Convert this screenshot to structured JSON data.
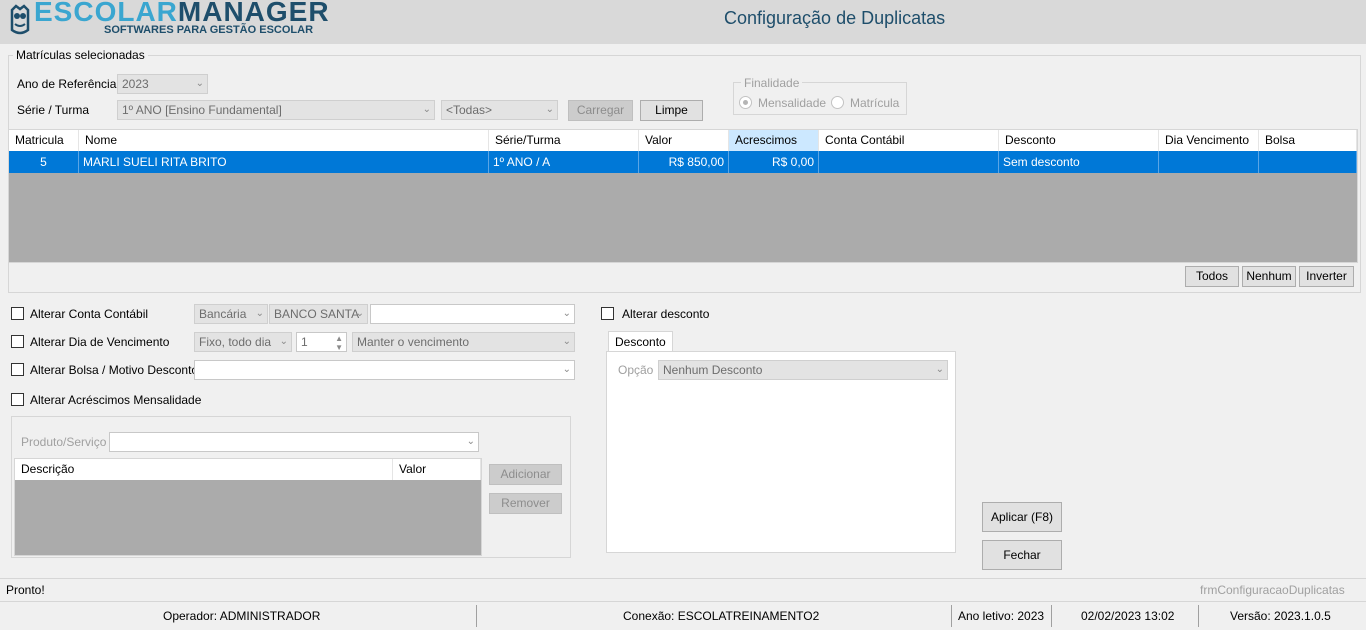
{
  "app": {
    "logo_main_a": "ESCOLAR",
    "logo_main_b": "MANAGER",
    "logo_sub": "SOFTWARES PARA GESTÃO ESCOLAR",
    "title": "Configuração de Duplicatas"
  },
  "matriculas": {
    "group_title": "Matrículas selecionadas",
    "ano_label": "Ano de Referência",
    "ano_value": "2023",
    "serie_label": "Série / Turma",
    "serie_value": "1º ANO [Ensino Fundamental]",
    "turma_value": "<Todas>",
    "carregar": "Carregar",
    "limpe": "Limpe",
    "finalidade": {
      "title": "Finalidade",
      "mensalidade": "Mensalidade",
      "matricula": "Matrícula"
    }
  },
  "grid": {
    "columns": [
      "Matricula",
      "Nome",
      "Série/Turma",
      "Valor",
      "Acrescimos",
      "Conta Contábil",
      "Desconto",
      "Dia Vencimento",
      "Bolsa"
    ],
    "rows": [
      {
        "matricula": "5",
        "nome": "MARLI SUELI RITA BRITO",
        "serie": "1º ANO / A",
        "valor": "R$ 850,00",
        "acrescimos": "R$ 0,00",
        "conta": "",
        "desconto": "Sem desconto",
        "dia": "",
        "bolsa": ""
      }
    ],
    "btn_todos": "Todos",
    "btn_nenhum": "Nenhum",
    "btn_inverter": "Inverter"
  },
  "options": {
    "alterar_conta": "Alterar Conta Contábil",
    "conta_tipo": "Bancária",
    "conta_banco": "BANCO SANTA",
    "conta_extra": "",
    "alterar_dia": "Alterar Dia de Vencimento",
    "dia_tipo": "Fixo, todo dia",
    "dia_num": "1",
    "dia_manter": "Manter o vencimento",
    "alterar_bolsa": "Alterar Bolsa / Motivo Desconto",
    "bolsa_value": "",
    "alterar_acrescimos": "Alterar Acréscimos Mensalidade",
    "produto_label": "Produto/Serviço",
    "produto_value": "",
    "desc_col": "Descrição",
    "valor_col": "Valor",
    "adicionar": "Adicionar",
    "remover": "Remover"
  },
  "desconto": {
    "alterar_desconto": "Alterar desconto",
    "tab": "Desconto",
    "opcao_label": "Opção",
    "opcao_value": "Nenhum Desconto"
  },
  "actions": {
    "aplicar": "Aplicar (F8)",
    "fechar": "Fechar"
  },
  "status": {
    "pronto": "Pronto!",
    "form_name": "frmConfiguracaoDuplicatas"
  },
  "statusbar": {
    "operador": "Operador: ADMINISTRADOR",
    "conexao": "Conexão: ESCOLATREINAMENTO2",
    "ano_letivo": "Ano letivo: 2023",
    "datetime": "02/02/2023 13:02",
    "versao": "Versão: 2023.1.0.5"
  },
  "icons": {
    "logo": "owl-logo-icon",
    "dropdown": "chevron-down-icon"
  }
}
